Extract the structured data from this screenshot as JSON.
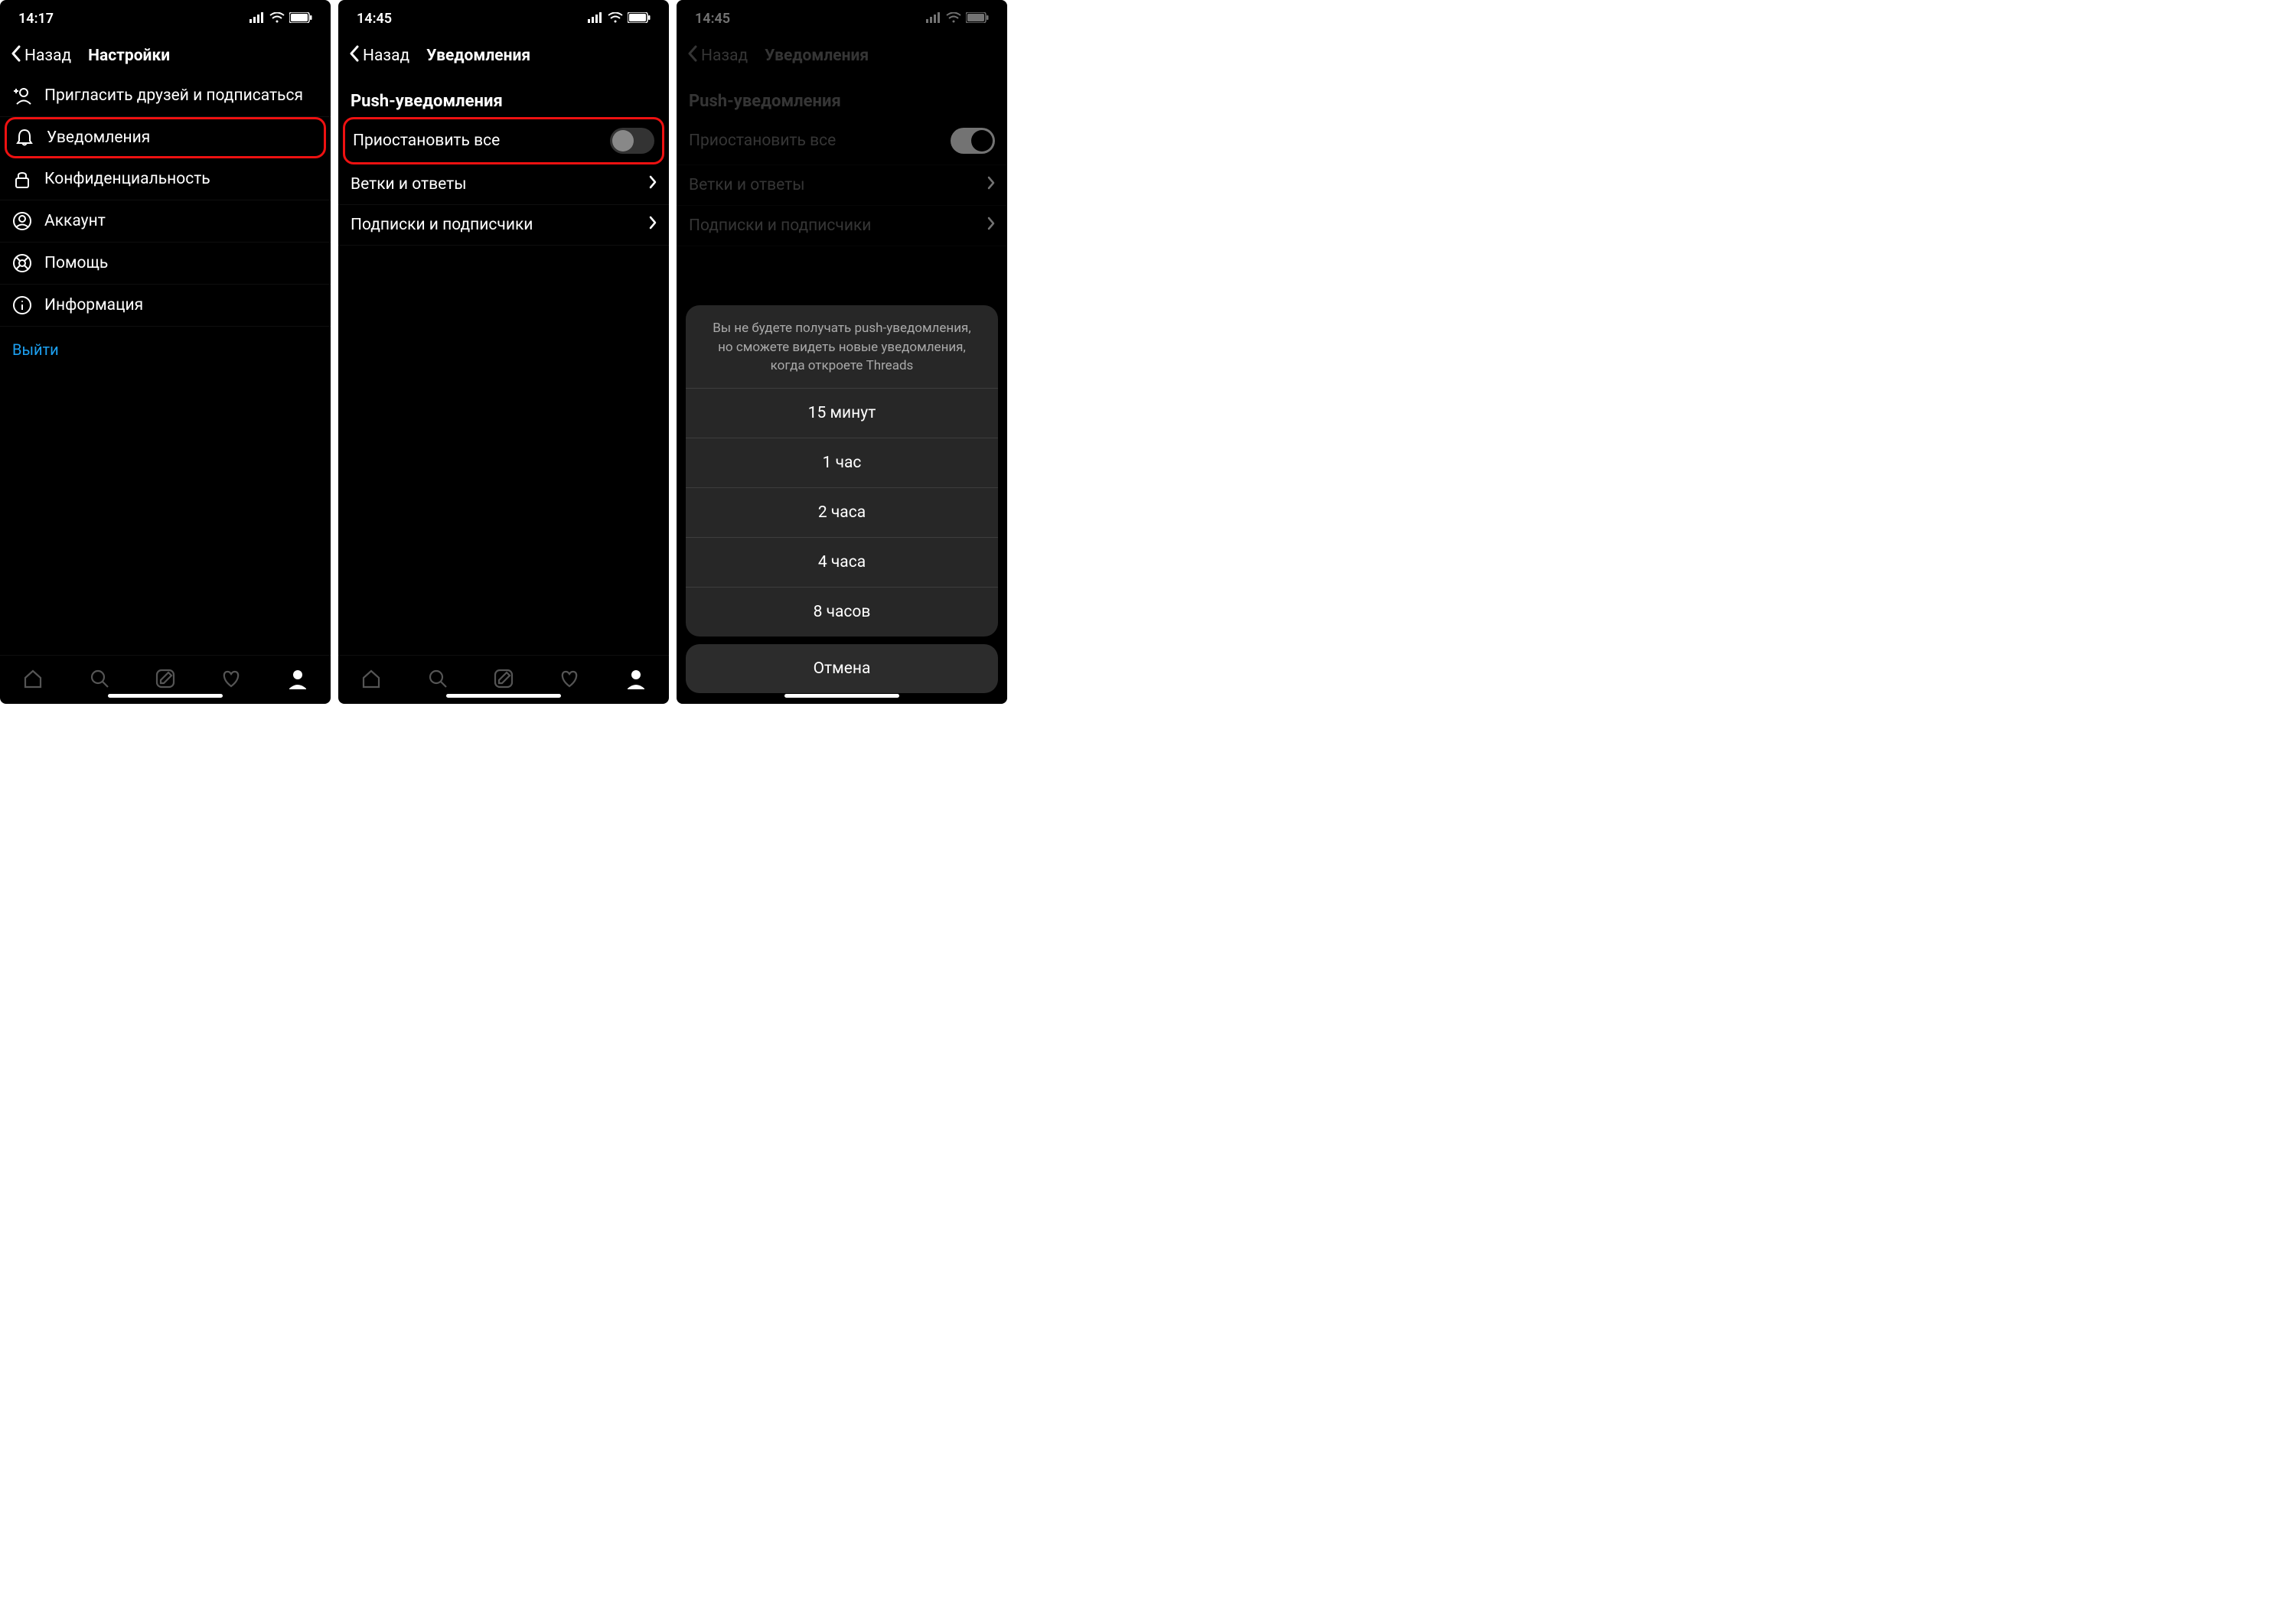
{
  "screen1": {
    "time": "14:17",
    "back": "Назад",
    "title": "Настройки",
    "items": {
      "invite": "Пригласить друзей и подписаться",
      "notifications": "Уведомления",
      "privacy": "Конфиденциальность",
      "account": "Аккаунт",
      "help": "Помощь",
      "info": "Информация"
    },
    "logout": "Выйти"
  },
  "screen2": {
    "time": "14:45",
    "back": "Назад",
    "title": "Уведомления",
    "section": "Push-уведомления",
    "pause_all": "Приостановить все",
    "threads_replies": "Ветки и ответы",
    "following_followers": "Подписки и подписчики"
  },
  "screen3": {
    "time": "14:45",
    "back": "Назад",
    "title": "Уведомления",
    "section": "Push-уведомления",
    "pause_all": "Приостановить все",
    "threads_replies": "Ветки и ответы",
    "following_followers": "Подписки и подписчики",
    "sheet_description": "Вы не будете получать push-уведомления, но сможете видеть новые уведомления, когда откроете Threads",
    "options": [
      "15 минут",
      "1 час",
      "2 часа",
      "4 часа",
      "8 часов"
    ],
    "cancel": "Отмена"
  }
}
